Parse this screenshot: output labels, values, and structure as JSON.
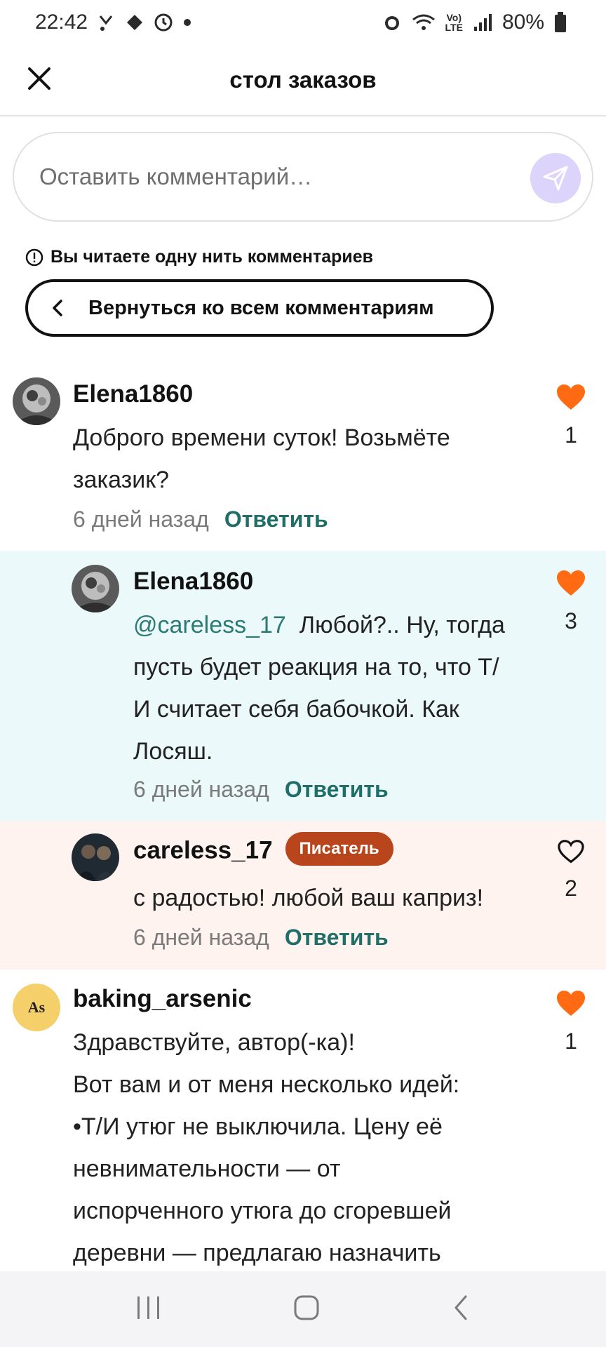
{
  "status_bar": {
    "time": "22:42",
    "battery": "80%"
  },
  "header": {
    "title": "стол заказов"
  },
  "comment_input": {
    "placeholder": "Оставить комментарий…"
  },
  "thread_notice": {
    "text": "Вы читаете одну нить комментариев",
    "back_label": "Вернуться ко всем комментариям"
  },
  "comments": [
    {
      "author": "Elena1860",
      "text": "Доброго времени суток! Возьмёте заказик?",
      "time": "6 дней назад",
      "reply_label": "Ответить",
      "likes": "1",
      "liked": true
    },
    {
      "author": "Elena1860",
      "mention": "@careless_17",
      "text": "Любой?.. Ну, тогда пусть будет реакция на то, что Т/И считает себя бабочкой. Как Лосяш.",
      "time": "6 дней назад",
      "reply_label": "Ответить",
      "likes": "3",
      "liked": true
    },
    {
      "author": "careless_17",
      "badge": "Писатель",
      "text": "с радостью! любой ваш каприз!",
      "time": "6 дней назад",
      "reply_label": "Ответить",
      "likes": "2",
      "liked": false
    },
    {
      "author": "baking_arsenic",
      "avatar_text": "As",
      "line1": "Здравствуйте, автор(-ка)!",
      "line2": "Вот вам и от меня несколько идей:",
      "line3": "•Т/И утюг не выключила. Цену её",
      "line4": "невнимательности — от",
      "line5": "испорченного утюга до сгоревшей",
      "line6": "деревни — предлагаю назначить",
      "likes": "1",
      "liked": true
    }
  ],
  "colors": {
    "accent_heart": "#ff6a13",
    "reply_link": "#1f6f68",
    "highlight_reply_bg": "#ebf9fb",
    "author_reply_bg": "#fef3ee",
    "badge_bg": "#b8451c",
    "send_button_bg": "#dcd4fb"
  }
}
